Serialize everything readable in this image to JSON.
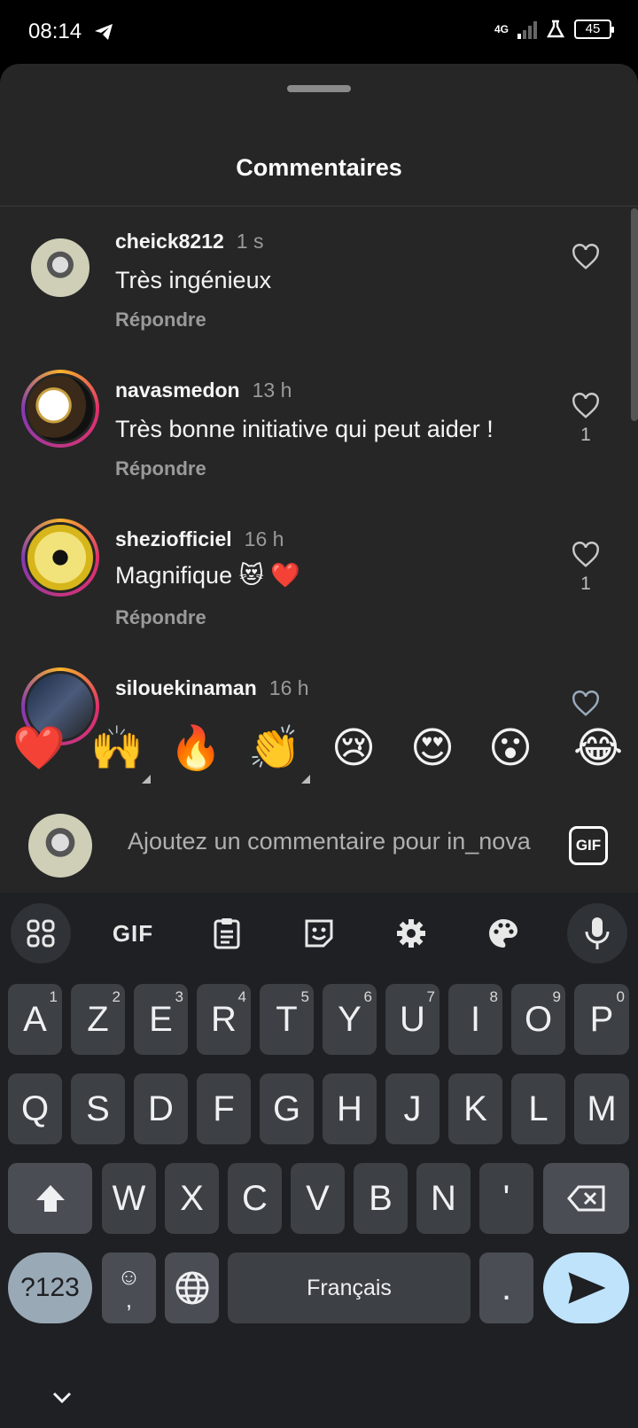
{
  "status": {
    "time": "08:14",
    "network": "4G",
    "battery": "45"
  },
  "sheet": {
    "title": "Commentaires"
  },
  "comments": [
    {
      "user": "cheick8212",
      "time": "1 s",
      "text": "Très ingénieux",
      "reply": "Répondre",
      "likes": ""
    },
    {
      "user": "navasmedon",
      "time": "13 h",
      "text": "Très bonne initiative qui peut aider !",
      "reply": "Répondre",
      "likes": "1"
    },
    {
      "user": "sheziofficiel",
      "time": "16 h",
      "text": "Magnifique 😻 ❤️",
      "reply": "Répondre",
      "likes": "1"
    },
    {
      "user": "silouekinaman",
      "time": "16 h",
      "text": "",
      "reply": "",
      "likes": ""
    }
  ],
  "reactions": [
    "❤️",
    "🙌",
    "🔥",
    "👏",
    "😢",
    "😍",
    "😮",
    "😂"
  ],
  "input": {
    "placeholder": "Ajoutez un commentaire pour in_nova",
    "gif_label": "GIF"
  },
  "keyboard": {
    "toolbar_gif": "GIF",
    "row1": [
      {
        "k": "A",
        "h": "1"
      },
      {
        "k": "Z",
        "h": "2"
      },
      {
        "k": "E",
        "h": "3"
      },
      {
        "k": "R",
        "h": "4"
      },
      {
        "k": "T",
        "h": "5"
      },
      {
        "k": "Y",
        "h": "6"
      },
      {
        "k": "U",
        "h": "7"
      },
      {
        "k": "I",
        "h": "8"
      },
      {
        "k": "O",
        "h": "9"
      },
      {
        "k": "P",
        "h": "0"
      }
    ],
    "row2": [
      "Q",
      "S",
      "D",
      "F",
      "G",
      "H",
      "J",
      "K",
      "L",
      "M"
    ],
    "row3": [
      "W",
      "X",
      "C",
      "V",
      "B",
      "N",
      "'"
    ],
    "sym_label": "?123",
    "emoji_comma": ",",
    "space_label": "Français",
    "period": "."
  },
  "colors": {
    "sheet": "#262626",
    "keyboard": "#1e2023",
    "key": "#3d4044",
    "enter": "#bfe3fb"
  }
}
